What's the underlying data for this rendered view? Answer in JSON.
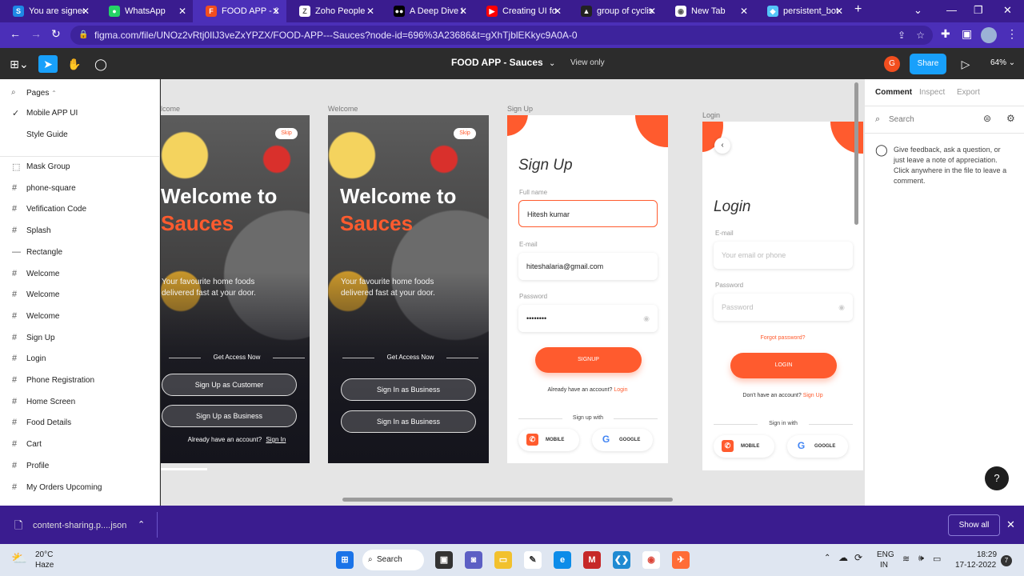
{
  "browser": {
    "tabs": [
      {
        "title": "You are signed",
        "icon": "s-app-icon",
        "color": "#1e88e5",
        "glyph": "S",
        "active": false
      },
      {
        "title": "WhatsApp",
        "icon": "whatsapp-icon",
        "color": "#25d366",
        "glyph": "●",
        "active": false
      },
      {
        "title": "FOOD APP - S",
        "icon": "figma-icon",
        "color": "#f24e1e",
        "glyph": "F",
        "active": true
      },
      {
        "title": "Zoho People",
        "icon": "zoho-icon",
        "color": "#ffffff",
        "glyph": "Z",
        "active": false
      },
      {
        "title": "A Deep Dive I",
        "icon": "medium-icon",
        "color": "#000000",
        "glyph": "●●",
        "active": false
      },
      {
        "title": "Creating UI fo",
        "icon": "youtube-icon",
        "color": "#ff0000",
        "glyph": "▶",
        "active": false
      },
      {
        "title": "group of cyclis",
        "icon": "image-icon",
        "color": "#222222",
        "glyph": "▲",
        "active": false
      },
      {
        "title": "New Tab",
        "icon": "chrome-icon",
        "color": "#ffffff",
        "glyph": "◉",
        "active": false
      },
      {
        "title": "persistent_bot",
        "icon": "flutter-icon",
        "color": "#54c5f8",
        "glyph": "◆",
        "active": false
      }
    ],
    "new_tab_label": "+",
    "url": "figma.com/file/UNOz2vRtj0IlJ3veZxYPZX/FOOD-APP---Sauces?node-id=696%3A23686&t=gXhTjblEKkyc9A0A-0"
  },
  "figma": {
    "file_title": "FOOD APP - Sauces",
    "view_only": "View only",
    "avatar_letter": "G",
    "share_label": "Share",
    "zoom": "64%"
  },
  "left_panel": {
    "pages_label": "Pages",
    "pages": [
      {
        "label": "Mobile APP UI",
        "selected": true
      },
      {
        "label": "Style Guide",
        "selected": false
      }
    ],
    "layers": [
      {
        "label": "Mask Group",
        "icon": "mask-group-icon",
        "glyph": "⬚"
      },
      {
        "label": "phone-square",
        "icon": "frame-icon",
        "glyph": "#"
      },
      {
        "label": "Vefification Code",
        "icon": "frame-icon",
        "glyph": "#"
      },
      {
        "label": "Splash",
        "icon": "frame-icon",
        "glyph": "#"
      },
      {
        "label": "Rectangle",
        "icon": "rectangle-icon",
        "glyph": "—"
      },
      {
        "label": "Welcome",
        "icon": "frame-icon",
        "glyph": "#"
      },
      {
        "label": "Welcome",
        "icon": "frame-icon",
        "glyph": "#"
      },
      {
        "label": "Welcome",
        "icon": "frame-icon",
        "glyph": "#"
      },
      {
        "label": "Sign Up",
        "icon": "frame-icon",
        "glyph": "#"
      },
      {
        "label": "Login",
        "icon": "frame-icon",
        "glyph": "#"
      },
      {
        "label": "Phone Registration",
        "icon": "frame-icon",
        "glyph": "#"
      },
      {
        "label": "Home Screen",
        "icon": "frame-icon",
        "glyph": "#"
      },
      {
        "label": "Food Details",
        "icon": "frame-icon",
        "glyph": "#"
      },
      {
        "label": "Cart",
        "icon": "frame-icon",
        "glyph": "#"
      },
      {
        "label": "Profile",
        "icon": "frame-icon",
        "glyph": "#"
      },
      {
        "label": "My Orders Upcoming",
        "icon": "frame-icon",
        "glyph": "#"
      }
    ]
  },
  "canvas": {
    "frame1": {
      "title": "lcome",
      "skip": "Skip",
      "welcome": "Welcome to",
      "sauces": "Sauces",
      "tagline": "Your favourite home foods delivered fast at your door.",
      "access": "Get Access Now",
      "btn1": "Sign Up as Customer",
      "btn2": "Sign Up as Business",
      "already": "Already have an account?",
      "signin": "Sign In"
    },
    "frame2": {
      "title": "Welcome",
      "skip": "Skip",
      "welcome": "Welcome to",
      "sauces": "Sauces",
      "tagline": "Your favourite home foods delivered fast at your door.",
      "access": "Get Access Now",
      "btn1": "Sign In as Business",
      "btn2": "Sign In as Business"
    },
    "signup": {
      "title": "Sign Up",
      "heading": "Sign Up",
      "fullname_label": "Full name",
      "fullname_value": "Hitesh kumar",
      "email_label": "E-mail",
      "email_value": "hiteshalaria@gmail.com",
      "password_label": "Password",
      "password_value": "••••••••",
      "button": "SIGNUP",
      "already": "Already have an account?",
      "login_link": "Login",
      "divider": "Sign up with",
      "mobile": "MOBILE",
      "google": "GOOGLE"
    },
    "login": {
      "title": "Login",
      "heading": "Login",
      "email_label": "E-mail",
      "email_placeholder": "Your email or phone",
      "password_label": "Password",
      "password_placeholder": "Password",
      "forgot": "Forgot password?",
      "button": "LOGIN",
      "no_account": "Don't have an account?",
      "signup_link": "Sign Up",
      "divider": "Sign in with",
      "mobile": "MOBILE",
      "google": "GOOGLE"
    },
    "help": "?"
  },
  "right_panel": {
    "tabs": [
      "Comment",
      "Inspect",
      "Export"
    ],
    "search_placeholder": "Search",
    "comment_hint": "Give feedback, ask a question, or just leave a note of appreciation. Click anywhere in the file to leave a comment."
  },
  "download_bar": {
    "file": "content-sharing.p....json",
    "show_all": "Show all"
  },
  "taskbar": {
    "temp": "20°C",
    "weather": "Haze",
    "search": "Search",
    "lang1": "ENG",
    "lang2": "IN",
    "time": "18:29",
    "date": "17-12-2022",
    "notif": "7"
  },
  "colors": {
    "accent": "#ff5b2e",
    "chrome_purple": "#4b2fb8",
    "figma_blue": "#18a0fb"
  }
}
